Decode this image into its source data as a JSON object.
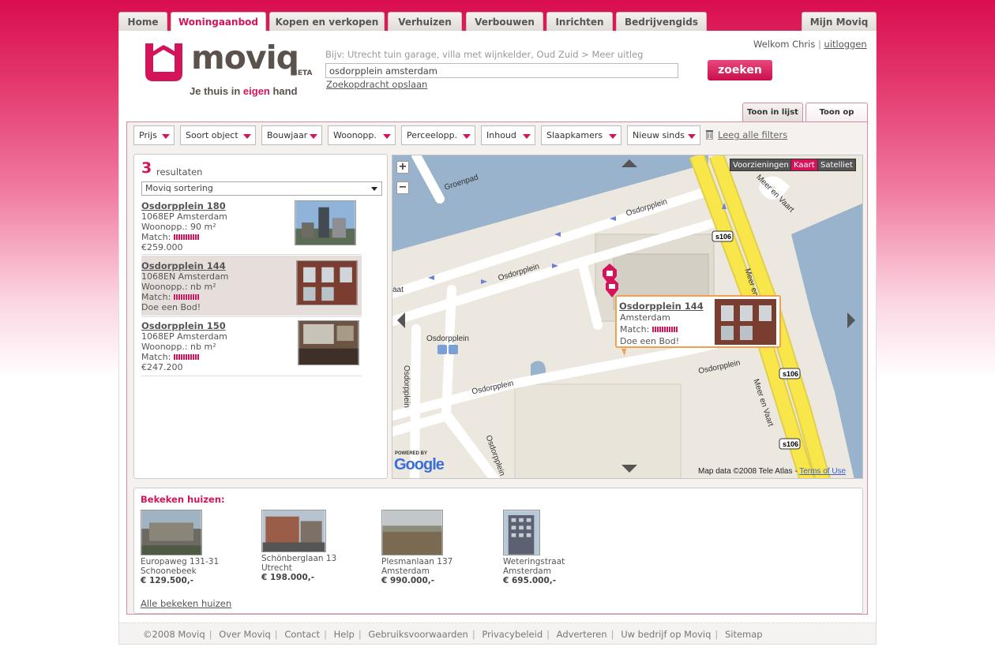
{
  "nav": {
    "tabs": [
      "Home",
      "Woningaanbod",
      "Kopen en verkopen",
      "Verhuizen",
      "Verbouwen",
      "Inrichten",
      "Bedrijvengids"
    ],
    "active_tab": "Woningaanbod",
    "right_tab": "Mijn Moviq"
  },
  "logo": {
    "name": "moviq",
    "beta": "BETA",
    "tagline_pre": "Je thuis in ",
    "tagline_hl": "eigen",
    "tagline_post": " hand"
  },
  "search": {
    "hint": "Bijv: Utrecht tuin garage, villa met wijnkelder, Oud Zuid > Meer uitleg",
    "value": "osdorpplein amsterdam",
    "save_link": "Zoekopdracht opslaan",
    "button": "zoeken"
  },
  "user": {
    "welcome": "Welkom Chris",
    "separator": "|",
    "logout": "uitloggen"
  },
  "view_tabs": {
    "list": "Toon in lijst",
    "map": "Toon op kaart",
    "active": "map"
  },
  "filters": [
    "Prijs",
    "Soort object",
    "Bouwjaar",
    "Woonopp.",
    "Perceelopp.",
    "Inhoud",
    "Slaapkamers",
    "Nieuw sinds"
  ],
  "clear_filters": "Leeg alle filters",
  "results": {
    "count": "3",
    "label": "resultaten",
    "sort": "Moviq sortering",
    "items": [
      {
        "title": "Osdorpplein 180",
        "city": "1068EP Amsterdam",
        "area": "Woonopp.: 90 m²",
        "match_label": "Match:",
        "match": 0.9,
        "extra": "€259.000",
        "selected": false
      },
      {
        "title": "Osdorpplein 144",
        "city": "1068EN Amsterdam",
        "area": "Woonopp.: nb m²",
        "match_label": "Match:",
        "match": 0.9,
        "extra": "Doe een Bod!",
        "selected": true
      },
      {
        "title": "Osdorpplein 150",
        "city": "1068EP Amsterdam",
        "area": "Woonopp.: nb m²",
        "match_label": "Match:",
        "match": 0.9,
        "extra": "€247.200",
        "selected": false
      }
    ]
  },
  "map": {
    "types": [
      "Voorzieningen",
      "Kaart",
      "Satelliet"
    ],
    "active_type": "Kaart",
    "zoom_in": "+",
    "zoom_out": "−",
    "labels": {
      "groenpad": "Groenpad",
      "osdorpplein": "Osdorpplein",
      "meer_en_vaart": "Meer en Vaart",
      "route": "s106",
      "bus": "Osdorpplein",
      "aat": "aat"
    },
    "popup": {
      "title": "Osdorpplein 144",
      "city": "Amsterdam",
      "match_label": "Match:",
      "match": 0.9,
      "extra": "Doe een Bod!"
    },
    "powered_by": "POWERED BY",
    "google": "Google",
    "attribution": "Map data ©2008 Tele Atlas - ",
    "terms": "Terms of Use"
  },
  "viewed": {
    "title": "Bekeken huizen:",
    "items": [
      {
        "street": "Europaweg 131-31",
        "city": "Schoonebeek",
        "price": "€ 129.500,-"
      },
      {
        "street": "Schönberglaan 13",
        "city": "Utrecht",
        "price": "€ 198.000,-"
      },
      {
        "street": "Plesmanlaan 137",
        "city": "Amsterdam",
        "price": "€ 990.000,-"
      },
      {
        "street": "Weteringstraat",
        "city": "Amsterdam",
        "price": "€ 695.000,-"
      }
    ],
    "all_link": "Alle bekeken huizen"
  },
  "footer": {
    "links": [
      "©2008 Moviq",
      "Over Moviq",
      "Contact",
      "Help",
      "Gebruiksvoorwaarden",
      "Privacybeleid",
      "Adverteren",
      "Uw bedrijf op Moviq",
      "Sitemap"
    ]
  },
  "colors": {
    "brand": "#d4145a",
    "popup_border": "#f0a050",
    "road_yellow": "#f9e64a"
  }
}
